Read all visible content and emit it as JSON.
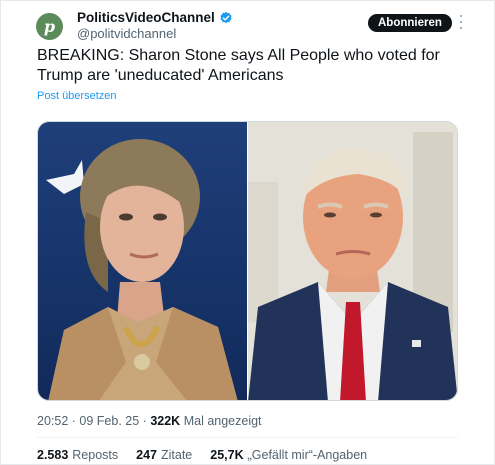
{
  "account": {
    "avatar_letter": "p",
    "display_name": "PoliticsVideoChannel",
    "handle": "@politvidchannel",
    "verified_color": "#1d9bf0"
  },
  "follow_button": "Abonnieren",
  "tweet": {
    "text": "BREAKING: Sharon Stone says All People who voted for Trump are 'uneducated' Americans",
    "translate": "Post übersetzen"
  },
  "media": {
    "left_photo": "photo-woman",
    "right_photo": "photo-man"
  },
  "meta": {
    "time": "20:52",
    "separator": "·",
    "date": "09 Feb. 25",
    "views_count": "322K",
    "views_label": "Mal angezeigt"
  },
  "stats": [
    {
      "count": "2.583",
      "label": "Reposts"
    },
    {
      "count": "247",
      "label": "Zitate"
    },
    {
      "count": "25,7K",
      "label": "„Gefällt mir“-Angaben"
    }
  ]
}
